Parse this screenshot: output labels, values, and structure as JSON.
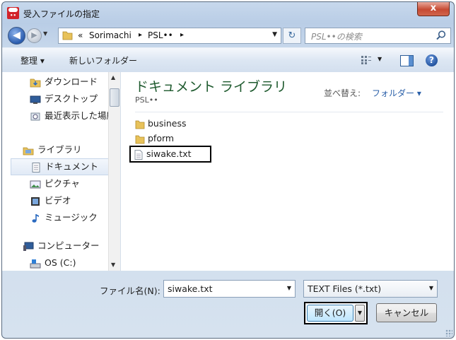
{
  "window": {
    "title": "受入ファイルの指定",
    "close_label": "x"
  },
  "navbar": {
    "back_glyph": "◀",
    "forward_glyph": "▶",
    "breadcrumb": [
      "«",
      "Sorimachi",
      "▸",
      "PSL••",
      "▸"
    ],
    "search_placeholder": "PSL••の検索"
  },
  "toolbar": {
    "organize": "整理 ▾",
    "new_folder": "新しいフォルダー",
    "help": "?"
  },
  "nav_pane": {
    "items": [
      {
        "label": "ダウンロード",
        "icon": "download-folder-icon"
      },
      {
        "label": "デスクトップ",
        "icon": "desktop-icon"
      },
      {
        "label": "最近表示した場所",
        "icon": "recent-places-icon"
      },
      {
        "label": "ライブラリ",
        "icon": "library-icon"
      },
      {
        "label": "ドキュメント",
        "icon": "documents-icon",
        "selected": true
      },
      {
        "label": "ピクチャ",
        "icon": "pictures-icon"
      },
      {
        "label": "ビデオ",
        "icon": "videos-icon"
      },
      {
        "label": "ミュージック",
        "icon": "music-icon"
      },
      {
        "label": "コンピューター",
        "icon": "computer-icon"
      },
      {
        "label": "OS (C:)",
        "icon": "drive-icon"
      }
    ]
  },
  "main": {
    "library_title": "ドキュメント ライブラリ",
    "library_subtitle": "PSL••",
    "sort_label": "並べ替え:",
    "sort_value": "フォルダー ▾",
    "files": [
      {
        "name": "business",
        "type": "folder"
      },
      {
        "name": "pform",
        "type": "folder"
      },
      {
        "name": "siwake.txt",
        "type": "text"
      }
    ]
  },
  "bottom": {
    "filename_label": "ファイル名(N):",
    "filename_value": "siwake.txt",
    "filetype_value": "TEXT Files (*.txt)",
    "open_label": "開く(O)",
    "cancel_label": "キャンセル"
  },
  "colors": {
    "library_title": "#1e5a2e",
    "link": "#2a5fa8",
    "selection_box": "#000000"
  }
}
